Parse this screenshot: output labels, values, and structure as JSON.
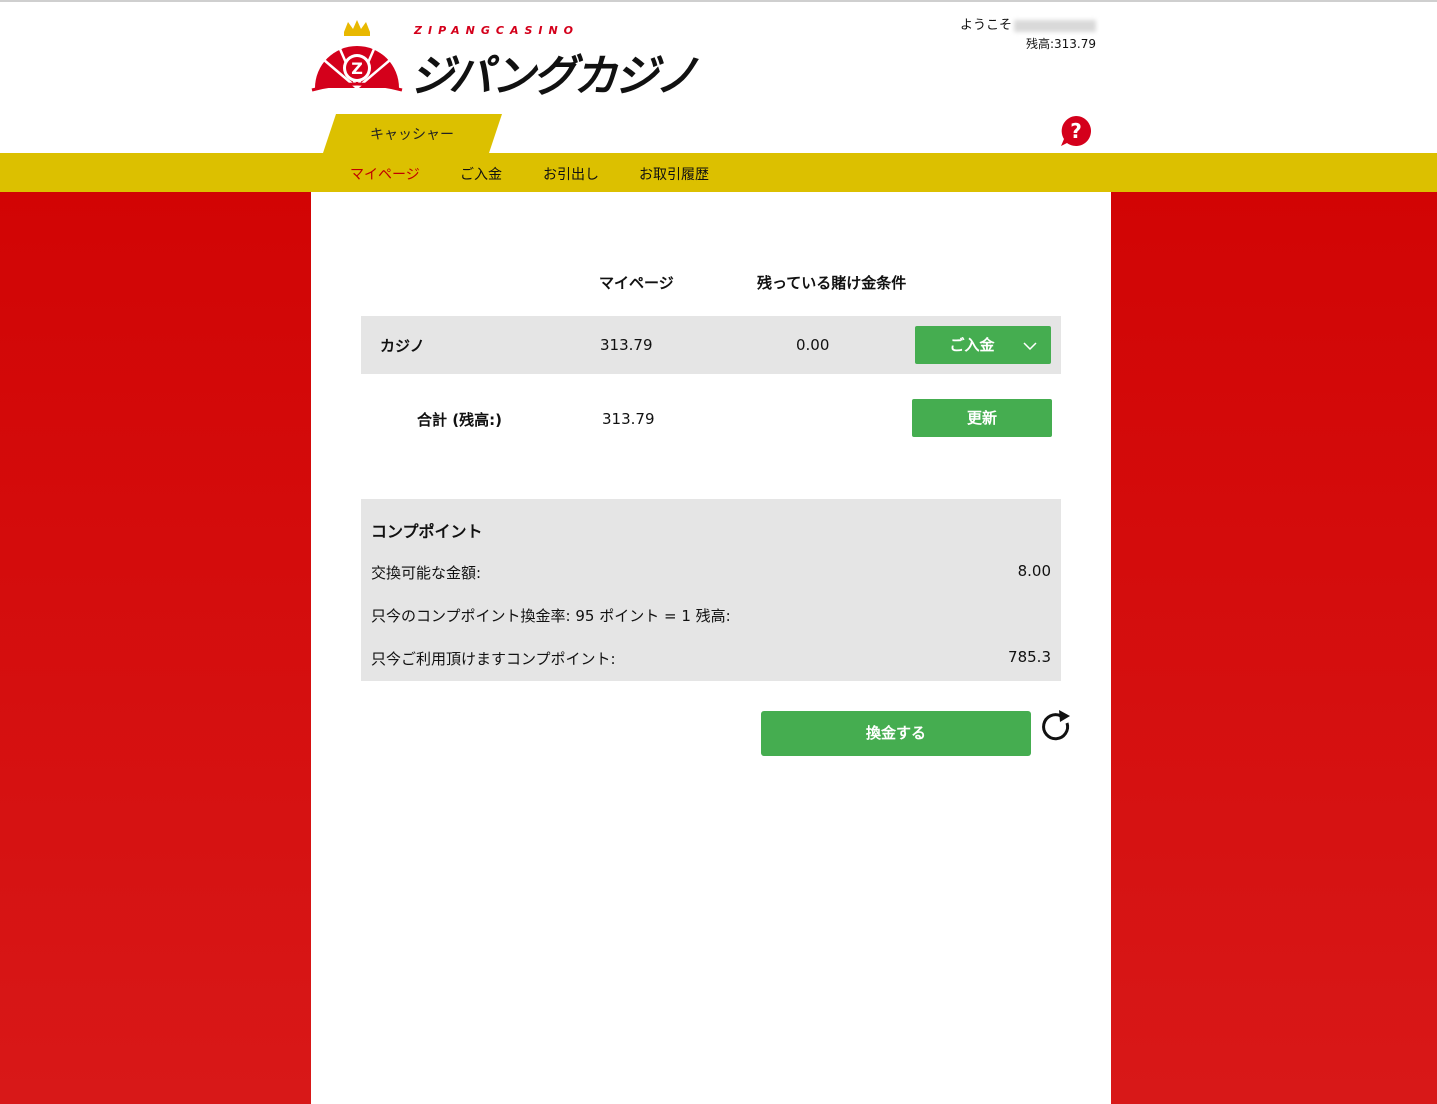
{
  "header": {
    "logo_en": "ZIPANGCASINO",
    "logo_jp": "ジパングカジノ",
    "welcome_label": "ようこそ",
    "balance_label": "残高:",
    "balance_value": "313.79"
  },
  "tabs": {
    "cashier": "キャッシャー"
  },
  "nav": {
    "mypage": "マイページ",
    "deposit": "ご入金",
    "withdraw": "お引出し",
    "history": "お取引履歴"
  },
  "table": {
    "col_mypage": "マイページ",
    "col_wagering": "残っている賭け金条件",
    "casino_label": "カジノ",
    "casino_balance": "313.79",
    "casino_wagering": "0.00",
    "deposit_button": "ご入金",
    "total_label": "合計 (残高:)",
    "total_value": "313.79",
    "update_button": "更新"
  },
  "comp": {
    "title": "コンプポイント",
    "exchangeable_label": "交換可能な金額:",
    "exchangeable_value": "8.00",
    "rate_label": "只今のコンプポイント換金率: 95 ポイント = 1 残高:",
    "available_label": "只今ご利用頂けますコンプポイント:",
    "available_value": "785.3",
    "exchange_button": "換金する"
  },
  "colors": {
    "brand_red": "#d00000",
    "nav_yellow": "#dcc000",
    "button_green": "#45ad50",
    "row_gray": "#e5e5e5"
  },
  "icons": [
    "crown-icon",
    "roulette-icon",
    "help-icon",
    "chevron-down-icon",
    "refresh-icon"
  ]
}
